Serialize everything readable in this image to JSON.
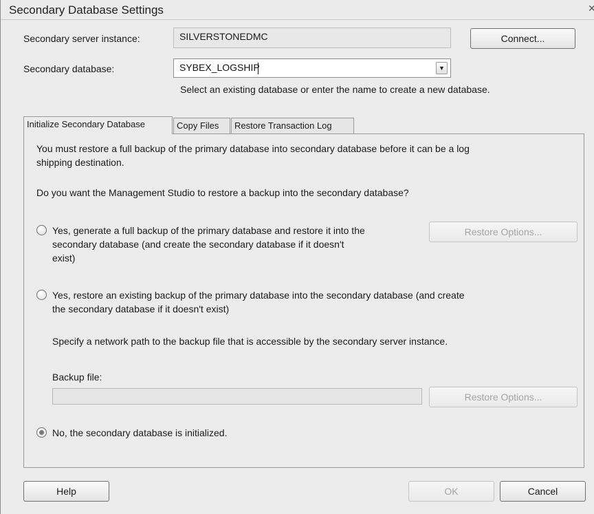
{
  "window": {
    "title": "Secondary Database Settings"
  },
  "server": {
    "label": "Secondary server instance:",
    "value": "SILVERSTONEDMC",
    "connect_button": "Connect..."
  },
  "database": {
    "label": "Secondary database:",
    "value": "SYBEX_LOGSHIP",
    "hint": "Select an existing database or enter the name to create a new database."
  },
  "tabs": [
    {
      "label": "Initialize Secondary Database",
      "active": true
    },
    {
      "label": "Copy Files",
      "active": false
    },
    {
      "label": "Restore Transaction Log",
      "active": false
    }
  ],
  "initialize": {
    "intro_line1": "You must restore a full backup of the primary database into secondary database before it can be a log",
    "intro_line2": "shipping destination.",
    "question": "Do you want the Management Studio to restore a backup into the secondary database?",
    "option1": {
      "line1": "Yes, generate a full backup of the primary database and restore it into the",
      "line2": "secondary database (and create the secondary database if it doesn't",
      "line3": "exist)",
      "selected": false,
      "restore_options": "Restore Options..."
    },
    "option2": {
      "line1": "Yes, restore an existing backup of the primary database into the secondary database (and create",
      "line2": "the secondary database if it doesn't exist)",
      "selected": false,
      "network_hint": "Specify a network path to the backup file that is accessible by the secondary server instance.",
      "backup_file_label": "Backup file:",
      "backup_file_value": "",
      "restore_options": "Restore Options..."
    },
    "option3": {
      "label": "No, the secondary database is initialized.",
      "selected": true
    }
  },
  "footer": {
    "help": "Help",
    "ok": "OK",
    "cancel": "Cancel"
  }
}
